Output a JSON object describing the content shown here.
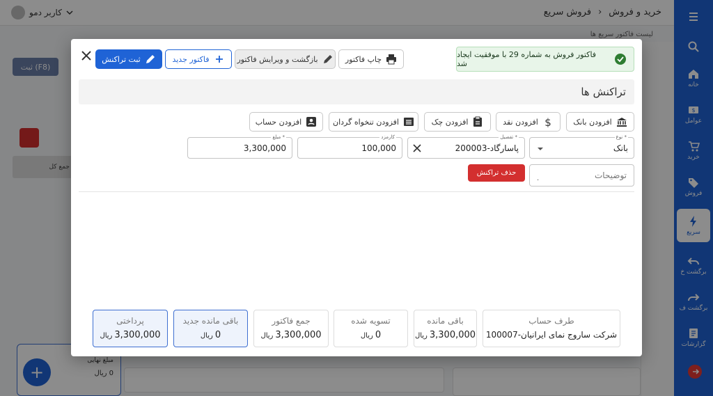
{
  "app": {
    "breadcrumb": [
      "خرید و فروش",
      "فروش سریع"
    ],
    "user_label": "کاربر دمو",
    "sub_bar": "لیست فاکتور سریع ها",
    "submit_f8": "ثبت (F8)",
    "total_label": "جمع کل",
    "final_amount_label": "مبلغ نهایی",
    "final_amount": "0 ریال",
    "sidebar": [
      {
        "label": "",
        "icon": "menu-icon"
      },
      {
        "label": "",
        "icon": "search-icon"
      },
      {
        "label": "خانه",
        "icon": "home-icon"
      },
      {
        "label": "عوامل",
        "icon": "contacts-icon"
      },
      {
        "label": "خرید",
        "icon": "cart-icon"
      },
      {
        "label": "فروش",
        "icon": "tag-icon"
      },
      {
        "label": "سریع",
        "icon": "bolt-icon"
      },
      {
        "label": "برگشت خ",
        "icon": "undo-icon"
      },
      {
        "label": "برگشت ف",
        "icon": "redo-icon"
      },
      {
        "label": "گزارشات",
        "icon": "report-icon"
      },
      {
        "label": "",
        "icon": "logout-icon"
      }
    ]
  },
  "modal": {
    "success_message": "فاکتور فروش به شماره 29 با موفقیت ایجاد شد",
    "actions": {
      "print": "چاپ فاکتور",
      "back_edit": "بازگشت و ویرایش فاکتور",
      "new_invoice": "فاکتور جدید",
      "submit_transaction": "ثبت تراکنش"
    },
    "section_title": "تراکنش ها",
    "add_buttons": {
      "bank": "افزودن بانک",
      "cash": "افزودن نقد",
      "cheque": "افزودن چک",
      "petty_cash": "افزودن تنخواه گردان",
      "account": "افزودن حساب"
    },
    "transaction": {
      "type_label": "نوع *",
      "type_value": "بانک",
      "detail_label": "تفصیل *",
      "detail_value": "پاسارگاد-200003",
      "fee_label": "کارمزد",
      "fee_value": "100,000",
      "amount_label": "مبلغ *",
      "amount_value": "3,300,000",
      "description_placeholder": "توضیحات",
      "description_value": ".",
      "delete_label": "حذف تراکنش"
    },
    "summary": {
      "counterparty": {
        "title": "طرف حساب",
        "value": "شرکت ساروج نمای ایرانیان-100007"
      },
      "remaining": {
        "title": "باقی مانده",
        "value": "3,300,000",
        "unit": "ریال"
      },
      "settled": {
        "title": "تسویه شده",
        "value": "0",
        "unit": "ریال"
      },
      "invoice_total": {
        "title": "جمع فاکتور",
        "value": "3,300,000",
        "unit": "ریال"
      },
      "new_remaining": {
        "title": "باقی مانده جدید",
        "value": "0",
        "unit": "ریال"
      },
      "paid": {
        "title": "پرداختی",
        "value": "3,300,000",
        "unit": "ریال"
      }
    }
  }
}
